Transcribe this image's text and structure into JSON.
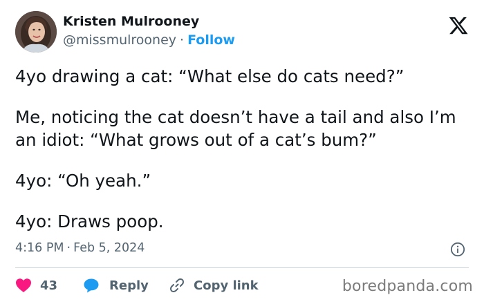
{
  "author": {
    "name": "Kristen Mulrooney",
    "handle": "@missmulrooney",
    "separator": "·",
    "follow_label": "Follow"
  },
  "tweet": {
    "paragraphs": [
      "4yo drawing a cat: “What else do cats need?”",
      "Me, noticing the cat doesn’t have a tail and also I’m an idiot: “What grows out of a cat’s bum?”",
      "4yo: “Oh yeah.”",
      "4yo: Draws poop."
    ],
    "time": "4:16 PM",
    "time_separator": "·",
    "date": "Feb 5, 2024"
  },
  "actions": {
    "like_count": "43",
    "reply_label": "Reply",
    "copy_link_label": "Copy link"
  },
  "watermark": "boredpanda.com",
  "colors": {
    "accent": "#1d9bf0",
    "like": "#f91880",
    "secondary_text": "#536471",
    "primary_text": "#0f1419"
  },
  "icons": [
    "x-logo-icon",
    "info-icon",
    "heart-icon",
    "reply-bubble-icon",
    "link-icon"
  ]
}
